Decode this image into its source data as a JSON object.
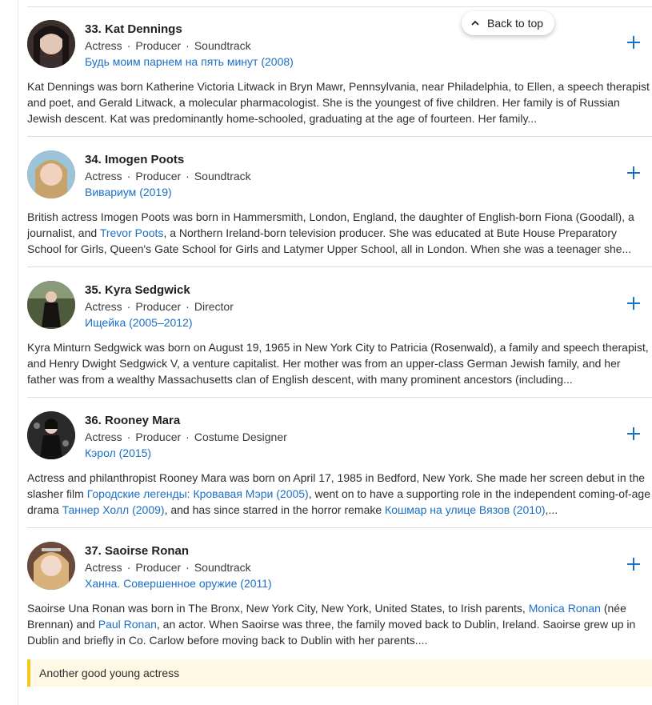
{
  "back_to_top": "Back to top",
  "items": [
    {
      "rank_name": "33. Kat Dennings",
      "roles": [
        "Actress",
        "Producer",
        "Soundtrack"
      ],
      "known_for": "Будь моим парнем на пять минут (2008)",
      "bio": "Kat Dennings was born Katherine Victoria Litwack in Bryn Mawr, Pennsylvania, near Philadelphia, to Ellen, a speech therapist and poet, and Gerald Litwack, a molecular pharmacologist. She is the youngest of five children. Her family is of Russian Jewish descent. Kat was predominantly home-schooled, graduating at the age of fourteen. Her family..."
    },
    {
      "rank_name": "34. Imogen Poots",
      "roles": [
        "Actress",
        "Producer",
        "Soundtrack"
      ],
      "known_for": "Вивариум (2019)",
      "bio_parts": [
        "British actress Imogen Poots was born in Hammersmith, London, England, the daughter of English-born Fiona (Goodall), a journalist, and ",
        "Trevor Poots",
        ", a Northern Ireland-born television producer. She was educated at Bute House Preparatory School for Girls, Queen's Gate School for Girls and Latymer Upper School, all in London. When she was a teenager she..."
      ]
    },
    {
      "rank_name": "35. Kyra Sedgwick",
      "roles": [
        "Actress",
        "Producer",
        "Director"
      ],
      "known_for": "Ищейка (2005–2012)",
      "bio": "Kyra Minturn Sedgwick was born on August 19, 1965 in New York City to Patricia (Rosenwald), a family and speech therapist, and Henry Dwight Sedgwick V, a venture capitalist. Her mother was from an upper-class German Jewish family, and her father was from a wealthy Massachusetts clan of English descent, with many prominent ancestors (including..."
    },
    {
      "rank_name": "36. Rooney Mara",
      "roles": [
        "Actress",
        "Producer",
        "Costume Designer"
      ],
      "known_for": "Кэрол (2015)",
      "bio_parts": [
        "Actress and philanthropist Rooney Mara was born on April 17, 1985 in Bedford, New York. She made her screen debut in the slasher film ",
        "Городские легенды: Кровавая Мэри (2005)",
        ", went on to have a supporting role in the independent coming-of-age drama ",
        "Таннер Холл (2009)",
        ", and has since starred in the horror remake ",
        "Кошмар на улице Вязов (2010)",
        ",..."
      ]
    },
    {
      "rank_name": "37. Saoirse Ronan",
      "roles": [
        "Actress",
        "Producer",
        "Soundtrack"
      ],
      "known_for": "Ханна. Совершенное оружие (2011)",
      "bio_parts": [
        "Saoirse Una Ronan was born in The Bronx, New York City, New York, United States, to Irish parents, ",
        "Monica Ronan",
        " (née Brennan) and ",
        "Paul Ronan",
        ", an actor. When Saoirse was three, the family moved back to Dublin, Ireland. Saoirse grew up in Dublin and briefly in Co. Carlow before moving back to Dublin with her parents...."
      ],
      "note": "Another good young actress"
    }
  ]
}
